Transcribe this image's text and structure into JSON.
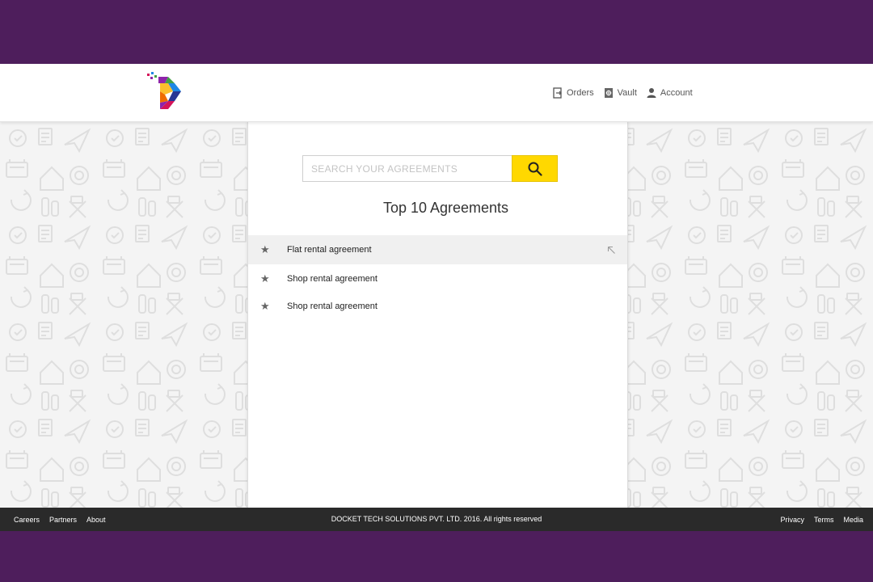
{
  "colors": {
    "frame": "#4e1e5c",
    "accent_yellow": "#ffd800",
    "footer_bg": "#2a2a2a",
    "pattern_bg": "#f4f4f4"
  },
  "header": {
    "logo_icon": "docket-logo-icon",
    "nav": [
      {
        "label": "Orders",
        "icon": "orders-icon"
      },
      {
        "label": "Vault",
        "icon": "vault-icon"
      },
      {
        "label": "Account",
        "icon": "account-icon"
      }
    ]
  },
  "search": {
    "placeholder": "SEARCH YOUR AGREEMENTS",
    "value": "",
    "button_icon": "search-icon"
  },
  "main": {
    "title": "Top 10 Agreements",
    "items": [
      {
        "label": "Flat rental agreement",
        "icon": "star-icon",
        "hovered": true
      },
      {
        "label": "Shop rental agreement",
        "icon": "star-icon",
        "hovered": false
      },
      {
        "label": "Shop rental agreement",
        "icon": "star-icon",
        "hovered": false
      }
    ]
  },
  "footer": {
    "left_links": [
      "Careers",
      "Partners",
      "About"
    ],
    "copyright": "DOCKET TECH SOLUTIONS PVT. LTD. 2016. All rights reserved",
    "right_links": [
      "Privacy",
      "Terms",
      "Media"
    ]
  }
}
